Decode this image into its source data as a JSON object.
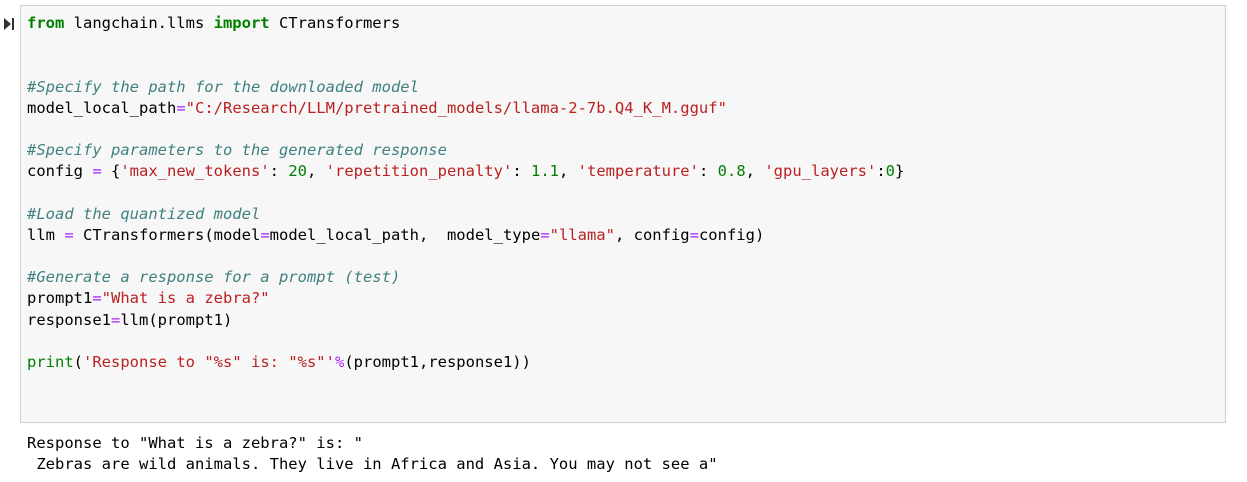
{
  "cell": {
    "lines": [
      {
        "text": "from langchain.llms import CTransformers"
      },
      {
        "text": ""
      },
      {
        "text": ""
      },
      {
        "text": "#Specify the path for the downloaded model"
      },
      {
        "text": "model_local_path=\"C:/Research/LLM/pretrained_models/llama-2-7b.Q4_K_M.gguf\""
      },
      {
        "text": ""
      },
      {
        "text": "#Specify parameters to the generated response"
      },
      {
        "text": "config = {'max_new_tokens': 20, 'repetition_penalty': 1.1, 'temperature': 0.8, 'gpu_layers':0}"
      },
      {
        "text": ""
      },
      {
        "text": "#Load the quantized model"
      },
      {
        "text": "llm = CTransformers(model=model_local_path,  model_type=\"llama\", config=config)"
      },
      {
        "text": ""
      },
      {
        "text": "#Generate a response for a prompt (test)"
      },
      {
        "text": "prompt1=\"What is a zebra?\""
      },
      {
        "text": "response1=llm(prompt1)"
      },
      {
        "text": ""
      },
      {
        "text": "print('Response to \"%s\" is: \"%s\"'%(prompt1,response1))"
      }
    ]
  },
  "output": {
    "lines": [
      "Response to \"What is a zebra?\" is: \"",
      " Zebras are wild animals. They live in Africa and Asia. You may not see a\""
    ]
  },
  "colors": {
    "keyword": "#008000",
    "comment": "#408080",
    "string": "#ba2121",
    "operator": "#aa22ff",
    "number": "#008000",
    "cell_background": "#f7f7f7",
    "cell_border": "#cfcfcf"
  },
  "icons": {
    "run_indicator": "step-forward-icon"
  }
}
